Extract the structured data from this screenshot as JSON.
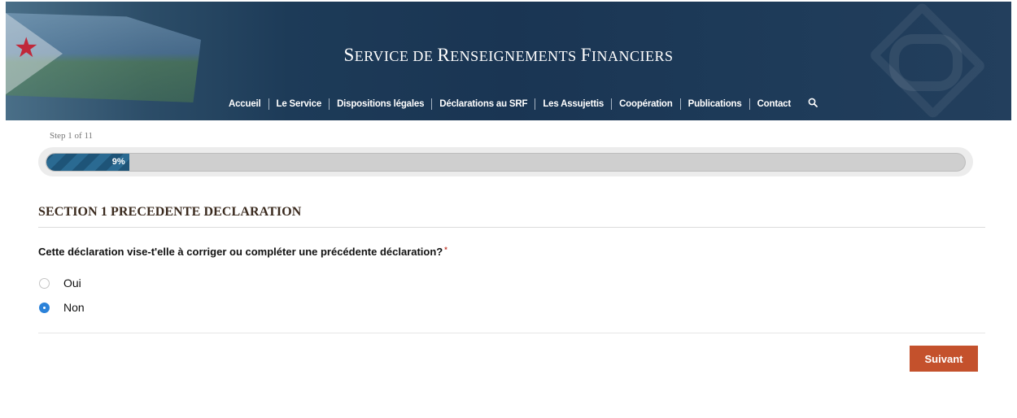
{
  "header": {
    "title_parts": [
      {
        "big": "S",
        "small": "ERVICE DE "
      },
      {
        "big": "R",
        "small": "ENSEIGNEMENTS "
      },
      {
        "big": "F",
        "small": "INANCIERS"
      }
    ],
    "nav": [
      {
        "label": "Accueil"
      },
      {
        "label": "Le Service"
      },
      {
        "label": "Dispositions légales"
      },
      {
        "label": "Déclarations au SRF"
      },
      {
        "label": "Les Assujettis"
      },
      {
        "label": "Coopération"
      },
      {
        "label": "Publications"
      },
      {
        "label": "Contact"
      }
    ],
    "search_icon": "search-icon",
    "flag_star_glyph": "★"
  },
  "progress": {
    "step_label": "Step 1 of 11",
    "percent_label": "9%",
    "fraction": 0.09
  },
  "section": {
    "title": "SECTION 1 PRECEDENTE DECLARATION",
    "question": "Cette déclaration vise-t'elle à corriger ou compléter une précédente déclaration?",
    "required_marker": "*",
    "options": [
      {
        "label": "Oui",
        "checked": false
      },
      {
        "label": "Non",
        "checked": true
      }
    ]
  },
  "actions": {
    "next_label": "Suivant"
  },
  "colors": {
    "header_bg": "#1d3b58",
    "progress_fill": "#1e5478",
    "radio_checked": "#2b82d9",
    "button": "#c4512c"
  }
}
